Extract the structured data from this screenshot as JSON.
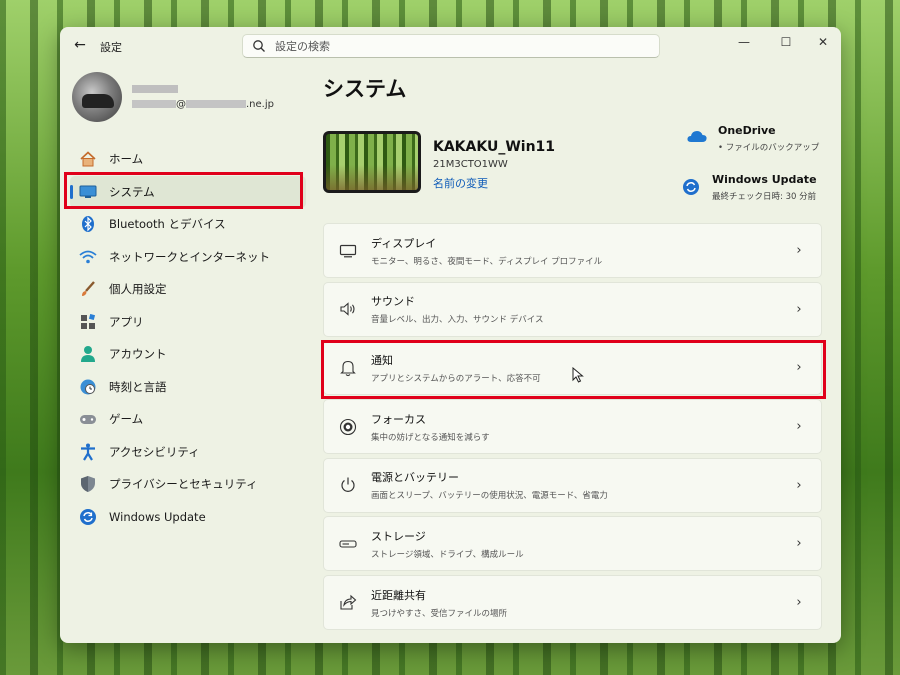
{
  "window": {
    "app_title": "設定",
    "search_placeholder": "設定の検索"
  },
  "user": {
    "email_suffix": "@",
    "email_domain": ".ne.jp"
  },
  "nav": {
    "items": [
      {
        "label": "ホーム",
        "icon": "home-icon"
      },
      {
        "label": "システム",
        "icon": "system-icon",
        "active": true
      },
      {
        "label": "Bluetooth とデバイス",
        "icon": "bluetooth-icon"
      },
      {
        "label": "ネットワークとインターネット",
        "icon": "wifi-icon"
      },
      {
        "label": "個人用設定",
        "icon": "brush-icon"
      },
      {
        "label": "アプリ",
        "icon": "apps-icon"
      },
      {
        "label": "アカウント",
        "icon": "account-icon"
      },
      {
        "label": "時刻と言語",
        "icon": "clock-globe-icon"
      },
      {
        "label": "ゲーム",
        "icon": "gamepad-icon"
      },
      {
        "label": "アクセシビリティ",
        "icon": "accessibility-icon"
      },
      {
        "label": "プライバシーとセキュリティ",
        "icon": "shield-icon"
      },
      {
        "label": "Windows Update",
        "icon": "update-icon"
      }
    ]
  },
  "main": {
    "title": "システム",
    "device": {
      "name": "KAKAKU_Win11",
      "model": "21M3CTO1WW",
      "rename_label": "名前の変更"
    },
    "onedrive": {
      "title": "OneDrive",
      "subtitle": "• ファイルのバックアップ"
    },
    "windows_update": {
      "title": "Windows Update",
      "subtitle": "最終チェック日時: 30 分前"
    },
    "settings": [
      {
        "title": "ディスプレイ",
        "subtitle": "モニター、明るさ、夜間モード、ディスプレイ プロファイル",
        "icon": "display-icon"
      },
      {
        "title": "サウンド",
        "subtitle": "音量レベル、出力、入力、サウンド デバイス",
        "icon": "speaker-icon"
      },
      {
        "title": "通知",
        "subtitle": "アプリとシステムからのアラート、応答不可",
        "icon": "bell-icon"
      },
      {
        "title": "フォーカス",
        "subtitle": "集中の妨げとなる通知を減らす",
        "icon": "focus-icon"
      },
      {
        "title": "電源とバッテリー",
        "subtitle": "画面とスリープ、バッテリーの使用状況、電源モード、省電力",
        "icon": "power-icon"
      },
      {
        "title": "ストレージ",
        "subtitle": "ストレージ領域、ドライブ、構成ルール",
        "icon": "storage-icon"
      },
      {
        "title": "近距離共有",
        "subtitle": "見つけやすさ、受信ファイルの場所",
        "icon": "share-icon"
      }
    ]
  },
  "colors": {
    "accent": "#1f6fcc",
    "highlight": "#e0001a"
  }
}
